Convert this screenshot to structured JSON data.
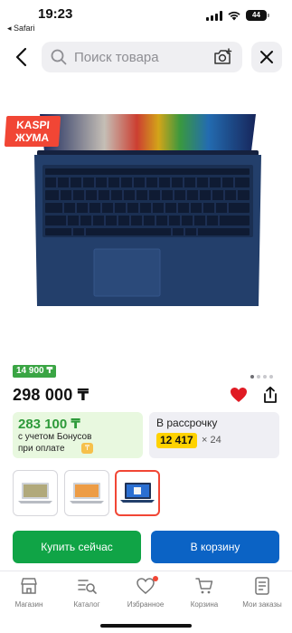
{
  "status_bar": {
    "time": "19:23",
    "back_app": "◂ Safari",
    "battery": "44"
  },
  "search": {
    "placeholder": "Поиск товара"
  },
  "product": {
    "promo_badge_line1": "KASPI",
    "promo_badge_line2": "ЖУМА",
    "image_count": 4,
    "active_image": 0,
    "bonus_badge": "14 900 ₸",
    "price": "298 000 ₸",
    "favorited": true
  },
  "bonus_card": {
    "value": "283 100 ₸",
    "line1": "с учетом Бонусов",
    "line2": "при оплате"
  },
  "installment_card": {
    "title": "В рассрочку",
    "amount": "12 417",
    "months": "× 24"
  },
  "thumbnails": [
    {
      "name": "thumbnail-front",
      "active": false
    },
    {
      "name": "thumbnail-angle",
      "active": false
    },
    {
      "name": "thumbnail-side",
      "active": true
    }
  ],
  "buttons": {
    "buy_now": "Купить сейчас",
    "add_to_cart": "В корзину"
  },
  "tabbar": [
    {
      "label": "Магазин",
      "icon": "store-icon"
    },
    {
      "label": "Каталог",
      "icon": "catalog-icon"
    },
    {
      "label": "Избранное",
      "icon": "heart-icon",
      "has_dot": true
    },
    {
      "label": "Корзина",
      "icon": "cart-icon"
    },
    {
      "label": "Мои заказы",
      "icon": "orders-icon"
    }
  ],
  "colors": {
    "green": "#10a446",
    "blue": "#0b63c5",
    "red": "#f14635",
    "yellow": "#ffd200"
  }
}
